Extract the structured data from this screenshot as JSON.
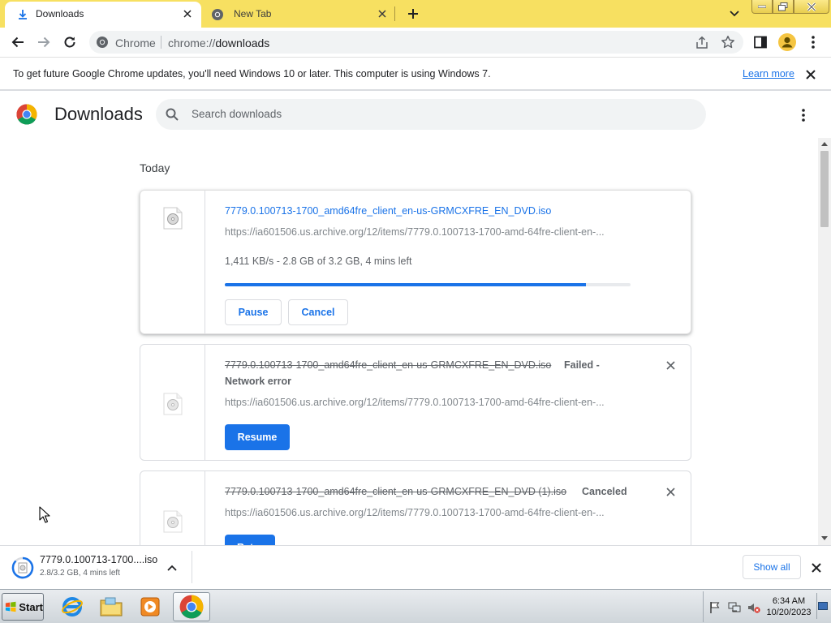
{
  "tabs": [
    {
      "title": "Downloads",
      "icon": "download-icon",
      "active": true
    },
    {
      "title": "New Tab",
      "icon": "chrome-icon",
      "active": false
    }
  ],
  "toolbar": {
    "omnibox_label": "Chrome",
    "url_scheme": "chrome://",
    "url_host": "downloads"
  },
  "infobar": {
    "message": "To get future Google Chrome updates, you'll need Windows 10 or later. This computer is using Windows 7.",
    "link": "Learn more"
  },
  "page": {
    "title": "Downloads",
    "search_placeholder": "Search downloads",
    "section": "Today"
  },
  "downloads": [
    {
      "filename": "7779.0.100713-1700_amd64fre_client_en-us-GRMCXFRE_EN_DVD.iso",
      "url": "https://ia601506.us.archive.org/12/items/7779.0.100713-1700-amd-64fre-client-en-...",
      "progress_text": "1,411 KB/s - 2.8 GB of 3.2 GB, 4 mins left",
      "progress_fraction": 0.89,
      "buttons": [
        "Pause",
        "Cancel"
      ]
    },
    {
      "filename": "7779.0.100713-1700_amd64fre_client_en-us-GRMCXFRE_EN_DVD.iso",
      "status_line1": "Failed -",
      "status_line2": "Network error",
      "url": "https://ia601506.us.archive.org/12/items/7779.0.100713-1700-amd-64fre-client-en-...",
      "button": "Resume"
    },
    {
      "filename": "7779.0.100713-1700_amd64fre_client_en-us-GRMCXFRE_EN_DVD (1).iso",
      "status": "Canceled",
      "url": "https://ia601506.us.archive.org/12/items/7779.0.100713-1700-amd-64fre-client-en-...",
      "button": "Retry"
    }
  ],
  "shelf": {
    "filename": "7779.0.100713-1700....iso",
    "status": "2.8/3.2 GB, 4 mins left",
    "show_all": "Show all"
  },
  "taskbar": {
    "start": "Start",
    "apps": [
      "internet-explorer-icon",
      "file-explorer-icon",
      "media-player-icon",
      "chrome-icon"
    ],
    "time": "6:34 AM",
    "date": "10/20/2023"
  },
  "colors": {
    "accent": "#1a73e8",
    "frame": "#f7e061"
  }
}
